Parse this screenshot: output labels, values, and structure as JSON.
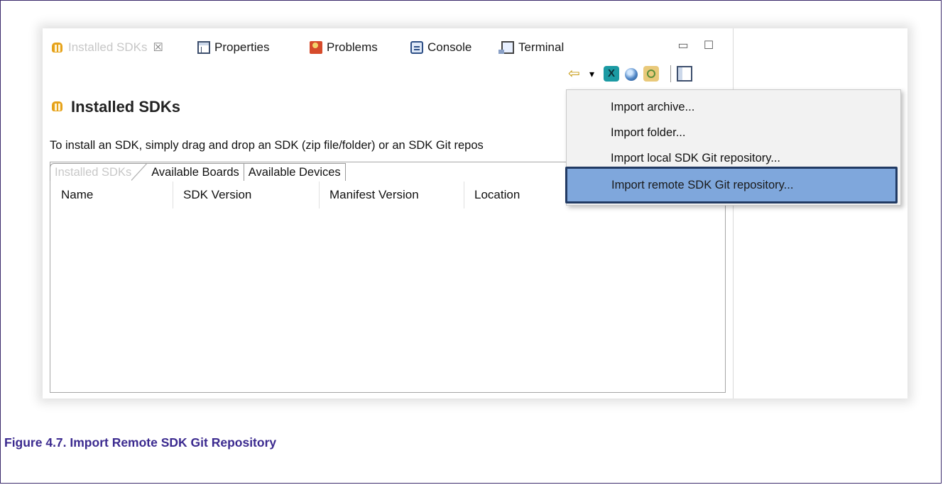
{
  "tabs": [
    {
      "label": "Installed SDKs",
      "icon": "sdk-icon"
    },
    {
      "label": "Properties",
      "icon": "properties-icon"
    },
    {
      "label": "Problems",
      "icon": "problems-icon"
    },
    {
      "label": "Console",
      "icon": "console-icon"
    },
    {
      "label": "Terminal",
      "icon": "terminal-icon"
    }
  ],
  "close_glyph": "☒",
  "window_controls": {
    "minimize": "▭",
    "maximize": "☐"
  },
  "toolbar": {
    "back_glyph": "⇦",
    "dropdown_glyph": "▾",
    "x_glyph": "X"
  },
  "view": {
    "title": "Installed SDKs",
    "hint": "To install an SDK, simply drag and drop an SDK (zip file/folder) or an SDK Git repos"
  },
  "subtabs": [
    "Installed SDKs",
    "Available Boards",
    "Available Devices"
  ],
  "columns": [
    "Name",
    "SDK Version",
    "Manifest Version",
    "Location"
  ],
  "menu": {
    "items": [
      "Import archive...",
      "Import folder...",
      "Import local SDK Git repository...",
      "Import remote SDK Git repository..."
    ],
    "highlighted_index": 3,
    "highlight_color": "#7fa7dc"
  },
  "caption": "Figure 4.7. Import Remote SDK Git Repository"
}
